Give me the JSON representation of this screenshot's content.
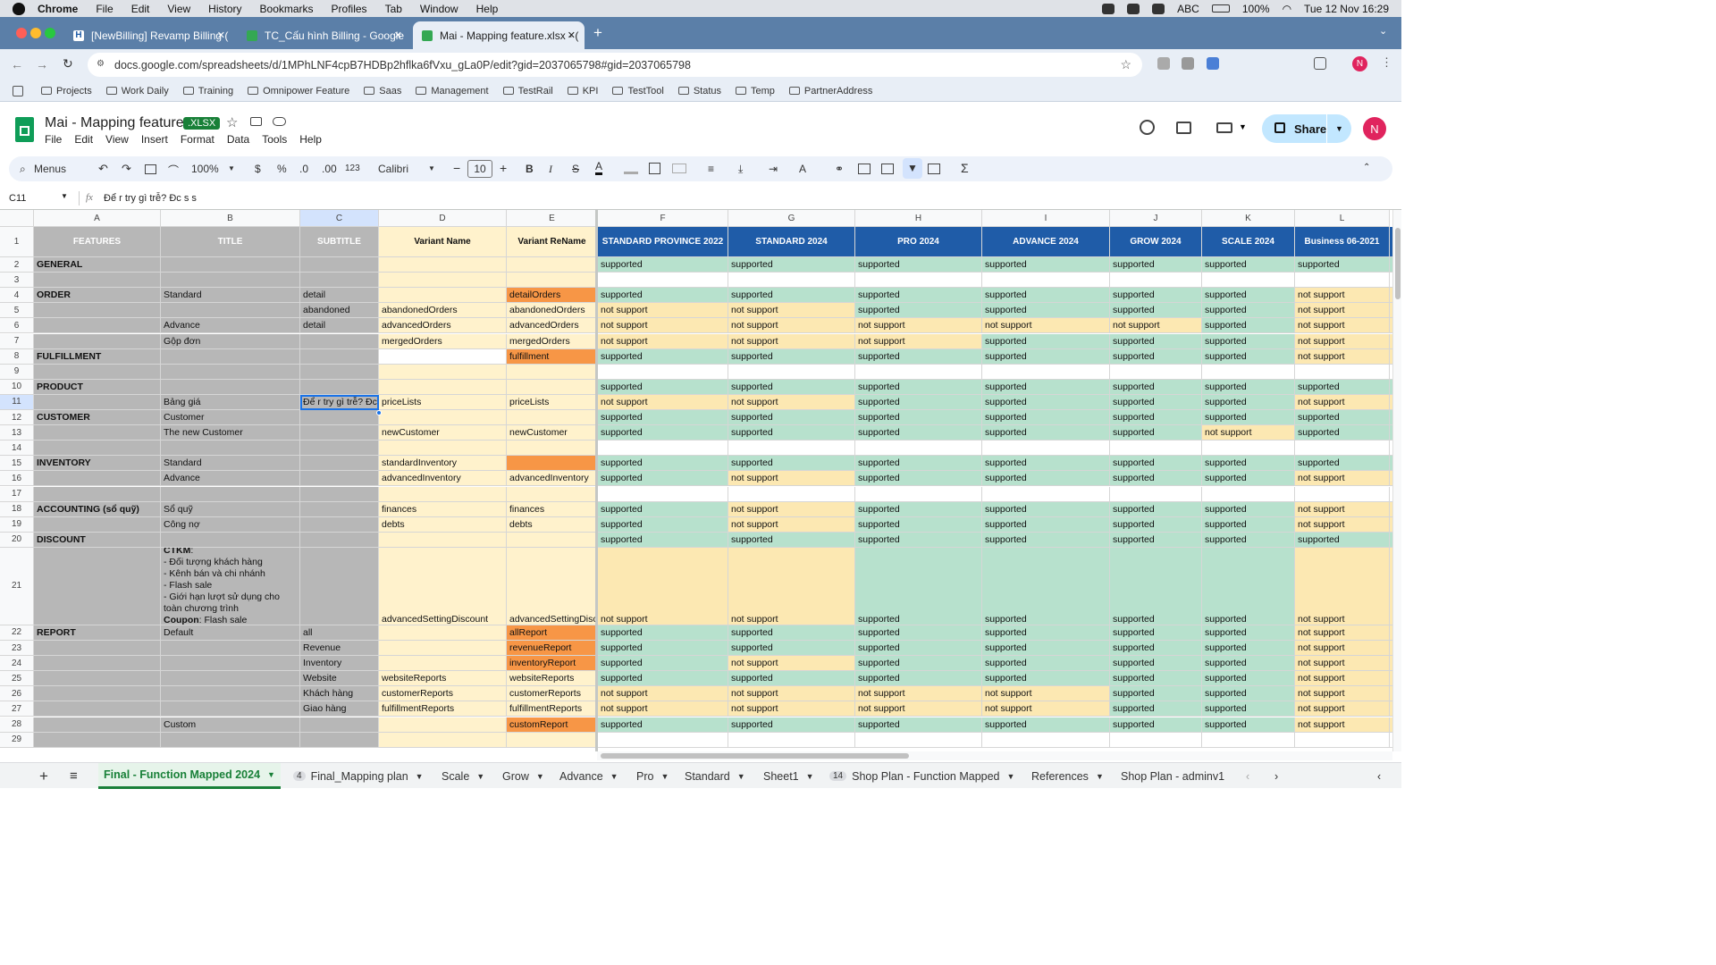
{
  "os": {
    "app": "Chrome",
    "menus": [
      "File",
      "Edit",
      "View",
      "History",
      "Bookmarks",
      "Profiles",
      "Tab",
      "Window",
      "Help"
    ],
    "status": {
      "input": "ABC",
      "battery": "100%",
      "datetime": "Tue 12 Nov  16:29"
    }
  },
  "tabs": [
    {
      "title": "[NewBilling] Revamp Billing (",
      "close": "✕"
    },
    {
      "title": "TC_Cấu hình Billing - Google",
      "close": "✕"
    },
    {
      "title": "Mai - Mapping feature.xlsx - (",
      "close": "✕"
    }
  ],
  "url": "docs.google.com/spreadsheets/d/1MPhLNF4cpB7HDBp2hflka6fVxu_gLa0P/edit?gid=2037065798#gid=2037065798",
  "bookmarks": [
    "Projects",
    "Work Daily",
    "Training",
    "Omnipower Feature",
    "Saas",
    "Management",
    "TestRail",
    "KPI",
    "TestTool",
    "Status",
    "Temp",
    "PartnerAddress"
  ],
  "doc": {
    "title": "Mai - Mapping feature",
    "badge": ".XLSX",
    "menus": [
      "File",
      "Edit",
      "View",
      "Insert",
      "Format",
      "Data",
      "Tools",
      "Help"
    ],
    "share": "Share",
    "avatar": "N"
  },
  "toolbar": {
    "search": "Menus",
    "zoom": "100%",
    "currency": "$",
    "percent": "%",
    "dec_less": ".0",
    "dec_more": ".00",
    "format": "123",
    "font": "Calibri",
    "size": "10"
  },
  "formula": {
    "ref": "C11",
    "value": "Để r try gì trễ? Đc s s"
  },
  "cols": {
    "letters": [
      "A",
      "B",
      "C",
      "D",
      "E",
      "F",
      "G",
      "H",
      "I",
      "J",
      "K",
      "L"
    ],
    "headers": [
      "FEATURES",
      "TITLE",
      "SUBTITLE",
      "Variant Name",
      "Variant ReName",
      "STANDARD PROVINCE 2022",
      "STANDARD 2024",
      "PRO 2024",
      "ADVANCE 2024",
      "GROW 2024",
      "SCALE 2024",
      "Business 06-2021"
    ]
  },
  "rows": [
    {
      "n": "2",
      "a": "GENERAL",
      "b": "",
      "c": "",
      "d": "",
      "e": "",
      "v": [
        "supported",
        "supported",
        "supported",
        "supported",
        "supported",
        "supported",
        "supported"
      ]
    },
    {
      "n": "3",
      "a": "",
      "b": "",
      "c": "",
      "d": "",
      "e": "",
      "v": [
        "",
        "",
        "",
        "",
        "",
        "",
        ""
      ]
    },
    {
      "n": "4",
      "a": "ORDER",
      "b": "Standard",
      "c": "detail",
      "d": "",
      "e": "detailOrders",
      "v": [
        "supported",
        "supported",
        "supported",
        "supported",
        "supported",
        "supported",
        "not support"
      ]
    },
    {
      "n": "5",
      "a": "",
      "b": "",
      "c": "abandoned",
      "d": "abandonedOrders",
      "e": "abandonedOrders",
      "v": [
        "not support",
        "not support",
        "supported",
        "supported",
        "supported",
        "supported",
        "not support"
      ]
    },
    {
      "n": "6",
      "a": "",
      "b": "Advance",
      "c": "detail",
      "d": "advancedOrders",
      "e": "advancedOrders",
      "v": [
        "not support",
        "not support",
        "not support",
        "not support",
        "not support",
        "supported",
        "not support"
      ]
    },
    {
      "n": "7",
      "a": "",
      "b": "Gộp đơn",
      "c": "",
      "d": "mergedOrders",
      "e": "mergedOrders",
      "v": [
        "not support",
        "not support",
        "not support",
        "supported",
        "supported",
        "supported",
        "not support"
      ]
    },
    {
      "n": "8",
      "a": "FULFILLMENT",
      "b": "",
      "c": "",
      "d": "",
      "e": "fulfillment",
      "v": [
        "supported",
        "supported",
        "supported",
        "supported",
        "supported",
        "supported",
        "not support"
      ]
    },
    {
      "n": "9",
      "a": "",
      "b": "",
      "c": "",
      "d": "",
      "e": "",
      "v": [
        "",
        "",
        "",
        "",
        "",
        "",
        ""
      ]
    },
    {
      "n": "10",
      "a": "PRODUCT",
      "b": "",
      "c": "",
      "d": "",
      "e": "",
      "v": [
        "supported",
        "supported",
        "supported",
        "supported",
        "supported",
        "supported",
        "supported"
      ]
    },
    {
      "n": "11",
      "a": "",
      "b": "Bảng giá",
      "c": "Để r try gì trễ? Đc s s",
      "d": "priceLists",
      "e": "priceLists",
      "v": [
        "not support",
        "not support",
        "supported",
        "supported",
        "supported",
        "supported",
        "not support"
      ]
    },
    {
      "n": "12",
      "a": "CUSTOMER",
      "b": "Customer",
      "c": "",
      "d": "",
      "e": "",
      "v": [
        "supported",
        "supported",
        "supported",
        "supported",
        "supported",
        "supported",
        "supported"
      ]
    },
    {
      "n": "13",
      "a": "",
      "b": "The new Customer",
      "c": "",
      "d": "newCustomer",
      "e": "newCustomer",
      "v": [
        "supported",
        "supported",
        "supported",
        "supported",
        "supported",
        "not support",
        "supported"
      ]
    },
    {
      "n": "14",
      "a": "",
      "b": "",
      "c": "",
      "d": "",
      "e": "",
      "v": [
        "",
        "",
        "",
        "",
        "",
        "",
        ""
      ]
    },
    {
      "n": "15",
      "a": "INVENTORY",
      "b": "Standard",
      "c": "",
      "d": "standardInventory",
      "e": "",
      "v": [
        "supported",
        "supported",
        "supported",
        "supported",
        "supported",
        "supported",
        "supported"
      ]
    },
    {
      "n": "16",
      "a": "",
      "b": "Advance",
      "c": "",
      "d": "advancedInventory",
      "e": "advancedInventory",
      "v": [
        "supported",
        "not support",
        "supported",
        "supported",
        "supported",
        "supported",
        "not support"
      ]
    },
    {
      "n": "17",
      "a": "",
      "b": "",
      "c": "",
      "d": "",
      "e": "",
      "v": [
        "",
        "",
        "",
        "",
        "",
        "",
        ""
      ]
    },
    {
      "n": "18",
      "a": "ACCOUNTING (sổ quỹ)",
      "b": "Sổ quỹ",
      "c": "",
      "d": "finances",
      "e": "finances",
      "v": [
        "supported",
        "not support",
        "supported",
        "supported",
        "supported",
        "supported",
        "not support"
      ]
    },
    {
      "n": "19",
      "a": "",
      "b": "Công nợ",
      "c": "",
      "d": "debts",
      "e": "debts",
      "v": [
        "supported",
        "not support",
        "supported",
        "supported",
        "supported",
        "supported",
        "not support"
      ]
    },
    {
      "n": "20",
      "a": "DISCOUNT",
      "b": "",
      "c": "",
      "d": "",
      "e": "",
      "v": [
        "supported",
        "supported",
        "supported",
        "supported",
        "supported",
        "supported",
        "supported"
      ]
    },
    {
      "n": "21",
      "a": "",
      "b": "",
      "c": "",
      "d": "advancedSettingDiscount",
      "e": "advancedSettingDiscount",
      "v": [
        "not support",
        "not support",
        "supported",
        "supported",
        "supported",
        "supported",
        "not support"
      ],
      "ctkm": {
        "l1": "CTKM",
        "l1b": ":",
        "l2": "- Đối tượng khách hàng",
        "l3": "- Kênh bán và chi nhánh",
        "l4": "- Flash sale",
        "l5": "- Giới hạn lượt sử dụng cho toàn chương trình",
        "l6": "Coupon",
        "l6b": ": Flash sale"
      }
    },
    {
      "n": "22",
      "a": "REPORT",
      "b": "Default",
      "c": "all",
      "d": "",
      "e": "allReport",
      "v": [
        "supported",
        "supported",
        "supported",
        "supported",
        "supported",
        "supported",
        "not support"
      ]
    },
    {
      "n": "23",
      "a": "",
      "b": "",
      "c": "Revenue",
      "d": "",
      "e": "revenueReport",
      "v": [
        "supported",
        "supported",
        "supported",
        "supported",
        "supported",
        "supported",
        "not support"
      ]
    },
    {
      "n": "24",
      "a": "",
      "b": "",
      "c": "Inventory",
      "d": "",
      "e": "inventoryReport",
      "v": [
        "supported",
        "not support",
        "supported",
        "supported",
        "supported",
        "supported",
        "not support"
      ]
    },
    {
      "n": "25",
      "a": "",
      "b": "",
      "c": "Website",
      "d": "websiteReports",
      "e": "websiteReports",
      "v": [
        "supported",
        "supported",
        "supported",
        "supported",
        "supported",
        "supported",
        "not support"
      ]
    },
    {
      "n": "26",
      "a": "",
      "b": "",
      "c": "Khách hàng",
      "d": "customerReports",
      "e": "customerReports",
      "v": [
        "not support",
        "not support",
        "not support",
        "not support",
        "supported",
        "supported",
        "not support"
      ]
    },
    {
      "n": "27",
      "a": "",
      "b": "",
      "c": "Giao hàng",
      "d": "fulfillmentReports",
      "e": "fulfillmentReports",
      "v": [
        "not support",
        "not support",
        "not support",
        "not support",
        "supported",
        "supported",
        "not support"
      ]
    },
    {
      "n": "28",
      "a": "",
      "b": "Custom",
      "c": "",
      "d": "",
      "e": "customReport",
      "v": [
        "supported",
        "supported",
        "supported",
        "supported",
        "supported",
        "supported",
        "not support"
      ]
    },
    {
      "n": "29",
      "a": "",
      "b": "",
      "c": "",
      "d": "",
      "e": "",
      "v": [
        "",
        "",
        "",
        "",
        "",
        "",
        ""
      ]
    }
  ],
  "orange_cells": [
    "detailOrders",
    "fulfillment",
    "allReport",
    "revenueReport",
    "inventoryReport",
    "customReport"
  ],
  "sheets": [
    {
      "name": "Final - Function Mapped 2024",
      "active": true
    },
    {
      "name": "Final_Mapping plan",
      "badge": "4"
    },
    {
      "name": "Scale"
    },
    {
      "name": "Grow"
    },
    {
      "name": "Advance"
    },
    {
      "name": "Pro"
    },
    {
      "name": "Standard"
    },
    {
      "name": "Sheet1"
    },
    {
      "name": "Shop Plan - Function Mapped",
      "badge": "14"
    },
    {
      "name": "References"
    },
    {
      "name": "Shop Plan - adminv1"
    }
  ],
  "colors": {
    "header_blue": "#1f5ca8",
    "supported": "#b7e1cd",
    "not_support": "#fce8b2",
    "orange": "#f6b26b",
    "gray": "#b7b7b7",
    "cream": "#fff2cc"
  }
}
